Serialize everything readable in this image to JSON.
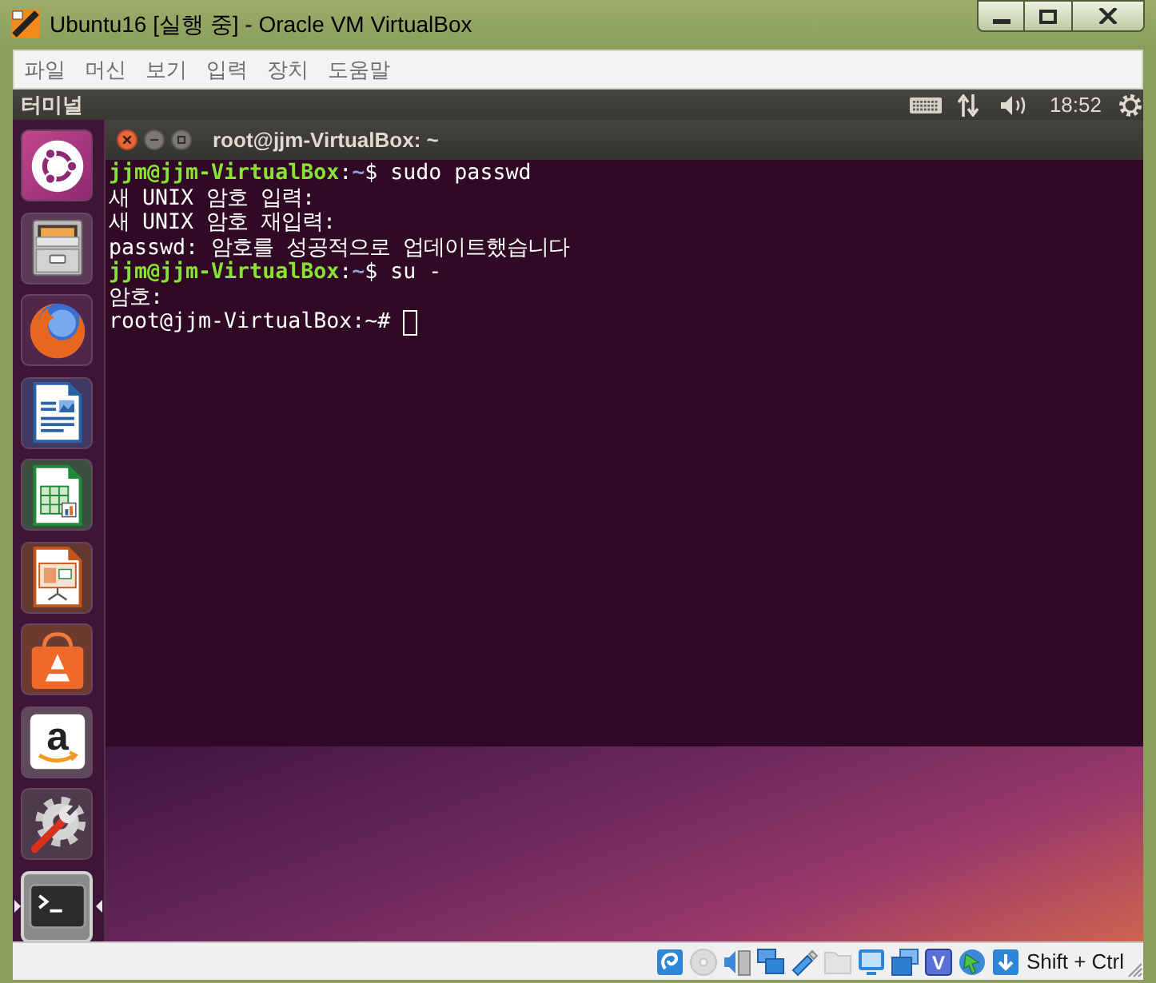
{
  "window": {
    "title": "Ubuntu16 [실행 중] - Oracle VM VirtualBox"
  },
  "menu": [
    "파일",
    "머신",
    "보기",
    "입력",
    "장치",
    "도움말"
  ],
  "top_panel": {
    "app_name": "터미널",
    "clock": "18:52"
  },
  "launcher": [
    {
      "kind": "dash",
      "selected": false
    },
    {
      "kind": "files",
      "selected": false
    },
    {
      "kind": "browser",
      "selected": false
    },
    {
      "kind": "writer",
      "selected": false
    },
    {
      "kind": "spreadsheet",
      "selected": false
    },
    {
      "kind": "presentation",
      "selected": false
    },
    {
      "kind": "store",
      "selected": false
    },
    {
      "kind": "shop",
      "selected": false,
      "glyph": "a"
    },
    {
      "kind": "settings",
      "selected": false
    },
    {
      "kind": "terminal",
      "selected": true
    }
  ],
  "terminal": {
    "title": "root@jjm-VirtualBox: ~",
    "cursor": true,
    "lines": [
      {
        "segments": [
          {
            "kind": "user",
            "text": "jjm@jjm-VirtualBox"
          },
          {
            "kind": "plain",
            "text": ":"
          },
          {
            "kind": "path",
            "text": "~"
          },
          {
            "kind": "plain",
            "text": "$ sudo passwd"
          }
        ]
      },
      {
        "segments": [
          {
            "kind": "plain",
            "text": "새 UNIX 암호 입력:"
          }
        ]
      },
      {
        "segments": [
          {
            "kind": "plain",
            "text": "새 UNIX 암호 재입력:"
          }
        ]
      },
      {
        "segments": [
          {
            "kind": "plain",
            "text": "passwd: 암호를 성공적으로 업데이트했습니다"
          }
        ]
      },
      {
        "segments": [
          {
            "kind": "user",
            "text": "jjm@jjm-VirtualBox"
          },
          {
            "kind": "plain",
            "text": ":"
          },
          {
            "kind": "path",
            "text": "~"
          },
          {
            "kind": "plain",
            "text": "$ su -"
          }
        ]
      },
      {
        "segments": [
          {
            "kind": "plain",
            "text": "암호:"
          }
        ]
      },
      {
        "segments": [
          {
            "kind": "plain",
            "text": "root@jjm-VirtualBox:~#"
          }
        ]
      }
    ]
  },
  "status_bar": {
    "indicators": [
      {
        "kind": "disk",
        "active": true
      },
      {
        "kind": "optical",
        "active": false
      },
      {
        "kind": "audio",
        "active": true
      },
      {
        "kind": "network",
        "active": true
      },
      {
        "kind": "usb",
        "active": true
      },
      {
        "kind": "shared",
        "active": false
      },
      {
        "kind": "display",
        "active": true
      },
      {
        "kind": "capture",
        "active": true
      },
      {
        "kind": "cpu",
        "active": true,
        "glyph": "V"
      },
      {
        "kind": "mouse",
        "active": true
      },
      {
        "kind": "hostkey",
        "active": true
      }
    ],
    "host_key": "Shift + Ctrl"
  }
}
